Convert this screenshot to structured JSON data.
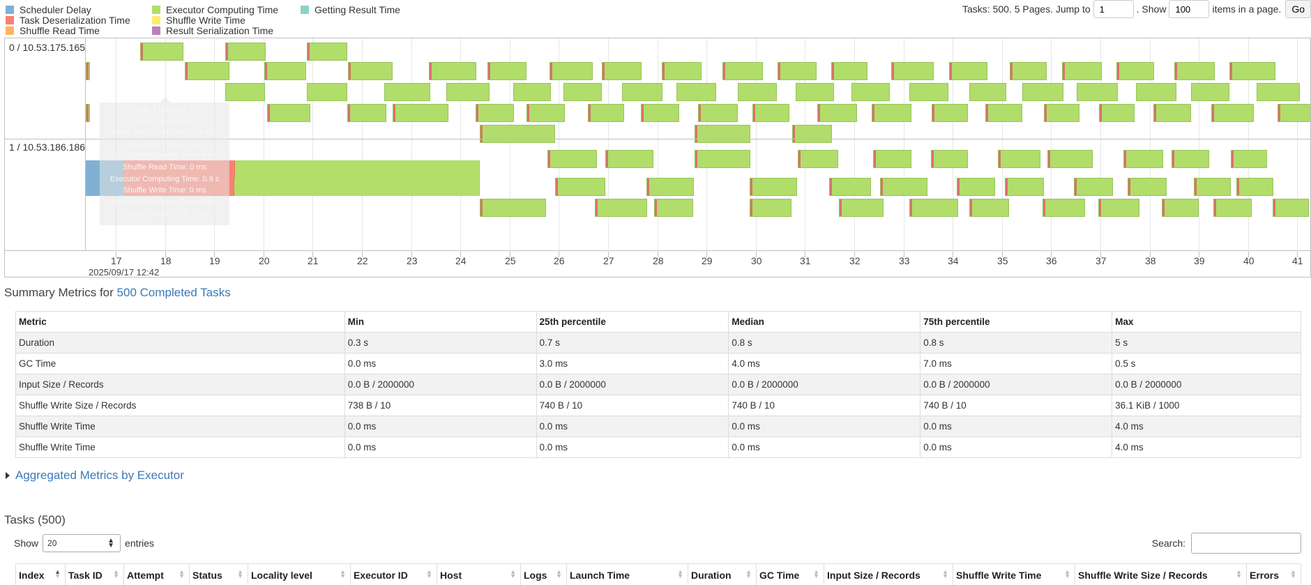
{
  "legend": [
    {
      "label": "Scheduler Delay",
      "color": "#80b1d3"
    },
    {
      "label": "Task Deserialization Time",
      "color": "#fb8072"
    },
    {
      "label": "Shuffle Read Time",
      "color": "#fdb462"
    },
    {
      "label": "Executor Computing Time",
      "color": "#b3de69"
    },
    {
      "label": "Shuffle Write Time",
      "color": "#ffed6f"
    },
    {
      "label": "Result Serialization Time",
      "color": "#bc80bd"
    },
    {
      "label": "Getting Result Time",
      "color": "#8dd3c7"
    }
  ],
  "pager": {
    "text1": "Tasks: 500. 5 Pages. Jump to",
    "page_value": "1",
    "text2": ". Show",
    "size_value": "100",
    "text3": "items in a page.",
    "go_label": "Go"
  },
  "timeline": {
    "executors": [
      "0 / 10.53.175.165",
      "1 / 10.53.186.186"
    ],
    "ticks": [
      "17",
      "18",
      "19",
      "20",
      "21",
      "22",
      "23",
      "24",
      "25",
      "26",
      "27",
      "28",
      "29",
      "30",
      "31",
      "32",
      "33",
      "34",
      "35",
      "36",
      "37",
      "38",
      "39",
      "40",
      "41"
    ],
    "axis_date": "2025/09/17 12:42",
    "tooltip": [
      "Task 4 (attempt 0)",
      "Status: SUCCESS",
      "Launch Time: 2025/09/17 12:42:17",
      "Scheduler Delay: 7 ms",
      "Task Deserialization Time: 4 ms",
      "Shuffle Read Time: 0 ms",
      "Executor Computing Time: 0.9 s",
      "Shuffle Write Time: 0 ms",
      "Result Serialization Time: 0 ms",
      "Getting Result Time: 0 ms"
    ]
  },
  "summary": {
    "title_prefix": "Summary Metrics for",
    "title_link": "500 Completed Tasks",
    "headers": [
      "Metric",
      "Min",
      "25th percentile",
      "Median",
      "75th percentile",
      "Max"
    ],
    "rows": [
      [
        "Duration",
        "0.3 s",
        "0.7 s",
        "0.8 s",
        "0.8 s",
        "5 s"
      ],
      [
        "GC Time",
        "0.0 ms",
        "3.0 ms",
        "4.0 ms",
        "7.0 ms",
        "0.5 s"
      ],
      [
        "Input Size / Records",
        "0.0 B / 2000000",
        "0.0 B / 2000000",
        "0.0 B / 2000000",
        "0.0 B / 2000000",
        "0.0 B / 2000000"
      ],
      [
        "Shuffle Write Size / Records",
        "738 B / 10",
        "740 B / 10",
        "740 B / 10",
        "740 B / 10",
        "36.1 KiB / 1000"
      ],
      [
        "Shuffle Write Time",
        "0.0 ms",
        "0.0 ms",
        "0.0 ms",
        "0.0 ms",
        "4.0 ms"
      ],
      [
        "Shuffle Write Time",
        "0.0 ms",
        "0.0 ms",
        "0.0 ms",
        "0.0 ms",
        "4.0 ms"
      ]
    ]
  },
  "aggregated_label": "Aggregated Metrics by Executor",
  "tasks": {
    "title": "Tasks (500)",
    "show_label": "Show",
    "entries_value": "20",
    "entries_label": "entries",
    "search_label": "Search:",
    "columns": [
      "Index",
      "Task ID",
      "Attempt",
      "Status",
      "Locality level",
      "Executor ID",
      "Host",
      "Logs",
      "Launch Time",
      "Duration",
      "GC Time",
      "Input Size / Records",
      "Shuffle Write Time",
      "Shuffle Write Size / Records",
      "Errors"
    ]
  }
}
